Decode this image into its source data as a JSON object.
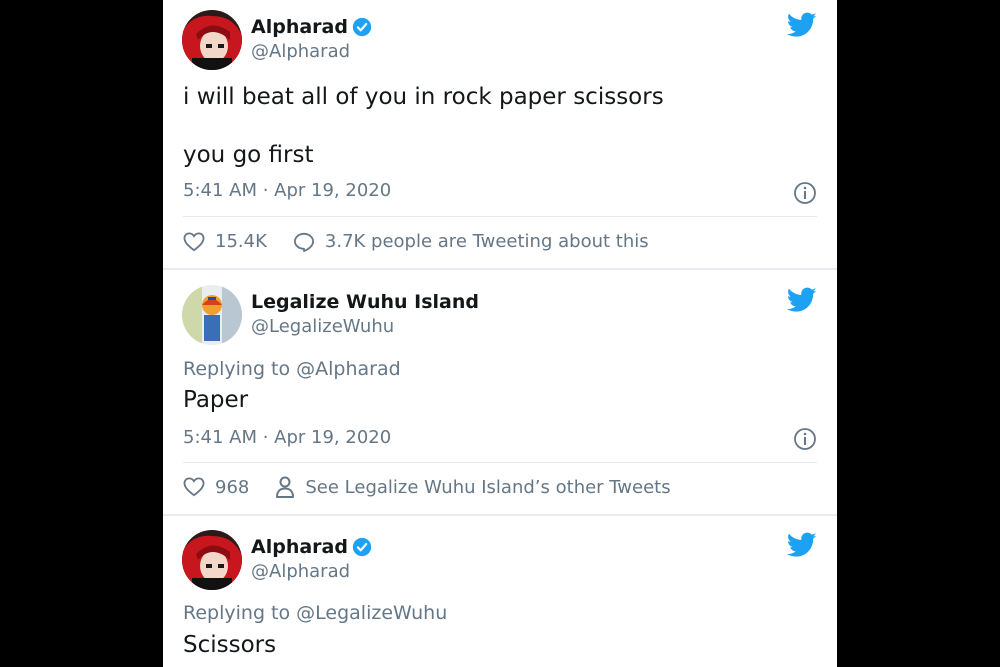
{
  "tweets": [
    {
      "display_name": "Alpharad",
      "handle": "@Alpharad",
      "verified": true,
      "text_lines": [
        "i will beat all of you in rock paper scissors",
        "you go first"
      ],
      "timestamp": "5:41 AM · Apr 19, 2020",
      "likes": "15.4K",
      "secondary_action": "3.7K people are Tweeting about this",
      "avatar_icon": "anime-avatar-red-hair"
    },
    {
      "display_name": "Legalize Wuhu Island",
      "handle": "@LegalizeWuhu",
      "verified": false,
      "replying_to": "Replying to @Alpharad",
      "text": "Paper",
      "timestamp": "5:41 AM · Apr 19, 2020",
      "likes": "968",
      "secondary_action": "See Legalize Wuhu Island’s other Tweets",
      "avatar_icon": "mii-avatar-wuhu"
    },
    {
      "display_name": "Alpharad",
      "handle": "@Alpharad",
      "verified": true,
      "replying_to": "Replying to @LegalizeWuhu",
      "text": "Scissors",
      "avatar_icon": "anime-avatar-red-hair"
    }
  ],
  "colors": {
    "twitter_blue": "#1da1f2",
    "text_primary": "#14171a",
    "text_secondary": "#657786",
    "divider": "#e6ecf0",
    "backdrop": "#000000"
  },
  "icons": {
    "verified": "verified-badge-icon",
    "bird": "twitter-bird-icon",
    "info": "info-icon",
    "heart": "heart-icon",
    "comment": "comment-bubble-icon",
    "person": "person-icon"
  }
}
